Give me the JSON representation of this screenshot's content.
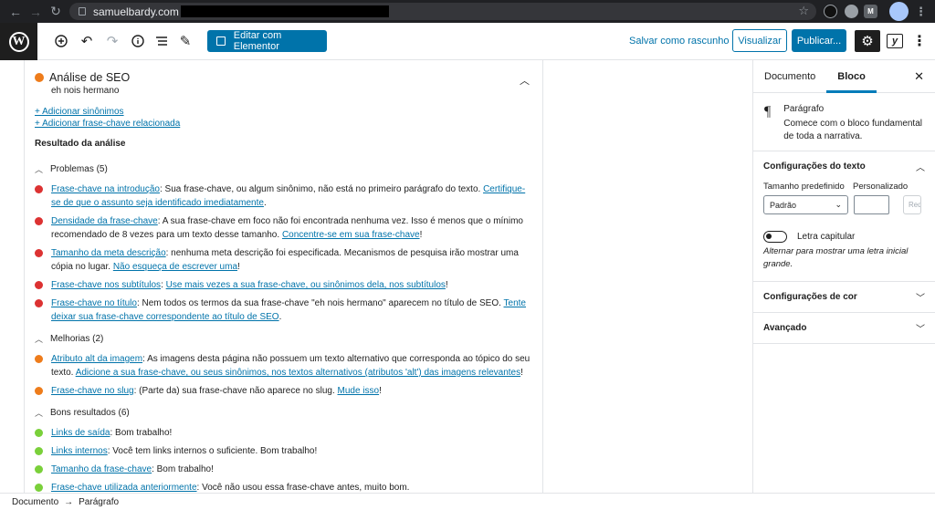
{
  "browser": {
    "url": "samuelbardy.com"
  },
  "toolbar": {
    "elementor_label": "Editar com Elementor",
    "draft_label": "Salvar como rascunho",
    "preview_label": "Visualizar",
    "publish_label": "Publicar..."
  },
  "seo": {
    "title": "Análise de SEO",
    "keyphrase": "eh nois hermano",
    "link_synonyms": "+ Adicionar sinônimos",
    "link_related": "+ Adicionar frase-chave relacionada",
    "results_title": "Resultado da análise",
    "problems_label": "Problemas (5)",
    "improvements_label": "Melhorias (2)",
    "good_label": "Bons resultados (6)"
  },
  "problems": [
    {
      "link": "Frase-chave na introdução",
      "text": ": Sua frase-chave, ou algum sinônimo, não está no primeiro parágrafo do texto. ",
      "link2": "Certifique-se de que o assunto seja identificado imediatamente",
      "tail": "."
    },
    {
      "link": "Densidade da frase-chave",
      "text": ": A sua frase-chave em foco não foi encontrada nenhuma vez. Isso é menos que o mínimo recomendado de 8 vezes para um texto desse tamanho. ",
      "link2": "Concentre-se em sua frase-chave",
      "tail": "!"
    },
    {
      "link": "Tamanho da meta descrição",
      "text": ": nenhuma meta descrição foi especificada. Mecanismos de pesquisa irão mostrar uma cópia no lugar. ",
      "link2": "Não esqueça de escrever uma",
      "tail": "!"
    },
    {
      "link": "Frase-chave nos subtítulos",
      "text": ": ",
      "link2": "Use mais vezes a sua frase-chave, ou sinônimos dela, nos subtítulos",
      "tail": "!"
    },
    {
      "link": "Frase-chave no título",
      "text": ": Nem todos os termos da sua frase-chave \"eh nois hermano\" aparecem no título de SEO. ",
      "link2": "Tente deixar sua frase-chave correspondente ao título de SEO",
      "tail": "."
    }
  ],
  "improvements": [
    {
      "link": "Atributo alt da imagem",
      "text": ": As imagens desta página não possuem um texto alternativo que corresponda ao tópico do seu texto. ",
      "link2": "Adicione a sua frase-chave, ou seus sinônimos, nos textos alternativos (atributos 'alt') das imagens relevantes",
      "tail": "!"
    },
    {
      "link": "Frase-chave no slug",
      "text": ": (Parte da) sua frase-chave não aparece no slug. ",
      "link2": "Mude isso",
      "tail": "!"
    }
  ],
  "good": [
    {
      "link": "Links de saída",
      "text": ": Bom trabalho!"
    },
    {
      "link": "Links internos",
      "text": ": Você tem links internos o suficiente. Bom trabalho!"
    },
    {
      "link": "Tamanho da frase-chave",
      "text": ": Bom trabalho!"
    },
    {
      "link": "Frase-chave utilizada anteriormente",
      "text": ": Você não usou essa frase-chave antes, muito bom."
    }
  ],
  "sidebar": {
    "tab_document": "Documento",
    "tab_block": "Bloco",
    "block_name": "Parágrafo",
    "block_desc": "Comece com o bloco fundamental de toda a narrativa.",
    "text_settings": "Configurações do texto",
    "preset_size_label": "Tamanho predefinido",
    "custom_label": "Personalizado",
    "preset_value": "Padrão",
    "reset_label": "Redefinir",
    "drop_cap_label": "Letra capitular",
    "drop_cap_help": "Alternar para mostrar uma letra inicial grande.",
    "color_settings": "Configurações de cor",
    "advanced": "Avançado"
  },
  "footer": {
    "crumb_document": "Documento",
    "arrow": "→",
    "crumb_paragraph": "Parágrafo"
  },
  "colors": {
    "primary": "#0073aa",
    "problem": "#dc3232",
    "improvement": "#ee7c1b",
    "good": "#7ad03a"
  }
}
